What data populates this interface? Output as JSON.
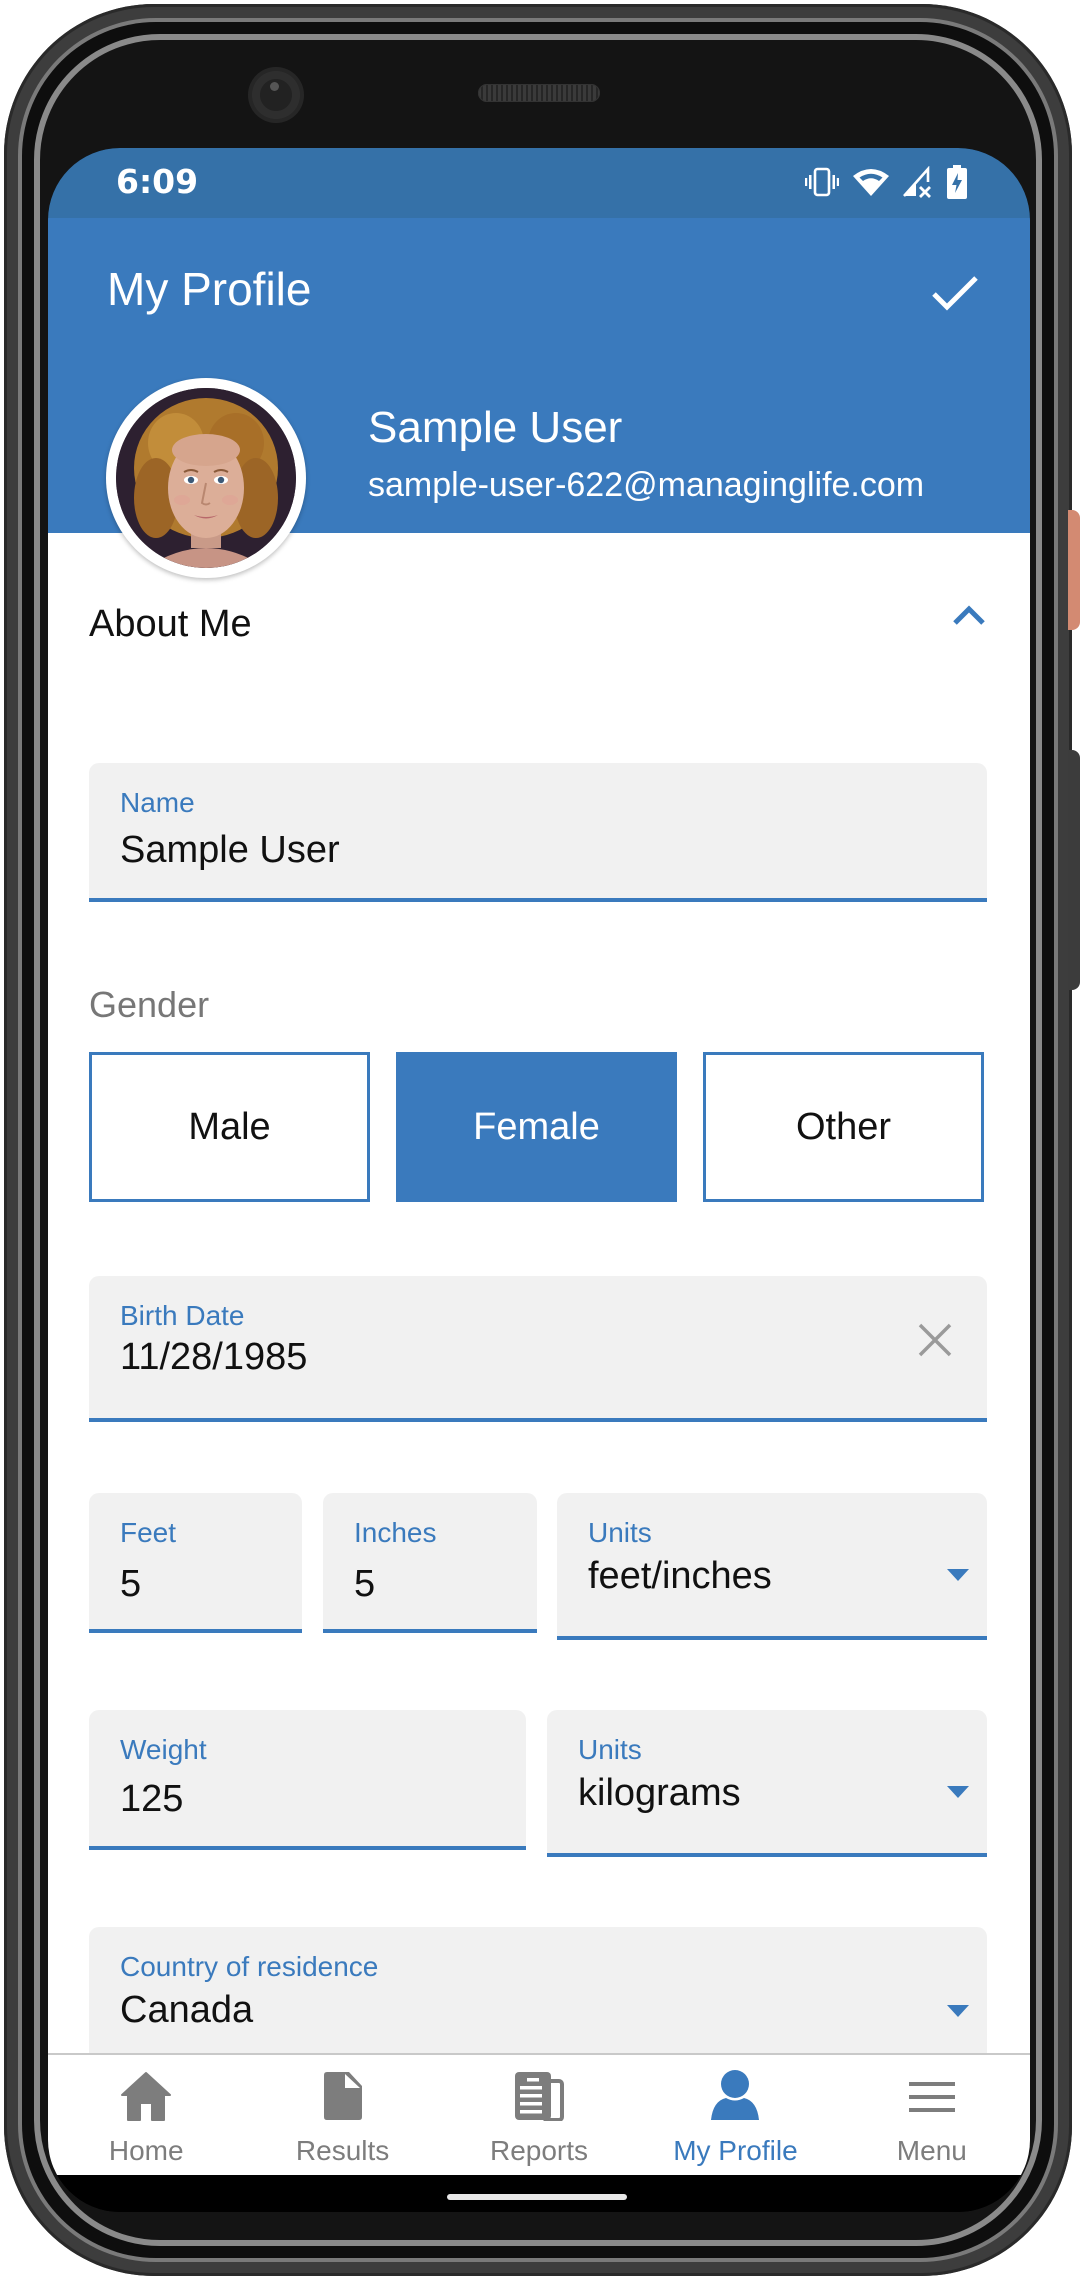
{
  "status_bar": {
    "time": "6:09",
    "icons": [
      "vibrate-icon",
      "wifi-icon",
      "cellular-no-signal-icon",
      "battery-charging-icon"
    ]
  },
  "header": {
    "title": "My Profile",
    "save_icon": "checkmark-icon"
  },
  "profile": {
    "name": "Sample User",
    "email": "sample-user-622@managinglife.com",
    "avatar_alt": "Profile photo"
  },
  "about_section": {
    "title": "About Me",
    "expanded": true,
    "toggle_icon": "chevron-up-icon"
  },
  "form": {
    "name": {
      "label": "Name",
      "value": "Sample User"
    },
    "gender": {
      "label": "Gender",
      "options": [
        "Male",
        "Female",
        "Other"
      ],
      "selected": "Female"
    },
    "birth_date": {
      "label": "Birth Date",
      "value": "11/28/1985",
      "clear_icon": "close-icon"
    },
    "height_feet": {
      "label": "Feet",
      "value": "5"
    },
    "height_inches": {
      "label": "Inches",
      "value": "5"
    },
    "height_units": {
      "label": "Units",
      "value": "feet/inches"
    },
    "weight": {
      "label": "Weight",
      "value": "125"
    },
    "weight_units": {
      "label": "Units",
      "value": "kilograms"
    },
    "country": {
      "label": "Country of residence",
      "value": "Canada"
    }
  },
  "bottom_nav": {
    "items": [
      {
        "label": "Home",
        "icon": "home-icon",
        "active": false
      },
      {
        "label": "Results",
        "icon": "document-icon",
        "active": false
      },
      {
        "label": "Reports",
        "icon": "reports-icon",
        "active": false
      },
      {
        "label": "My Profile",
        "icon": "person-icon",
        "active": true
      },
      {
        "label": "Menu",
        "icon": "hamburger-menu-icon",
        "active": false
      }
    ]
  },
  "colors": {
    "primary": "#3a7abd",
    "status_bar": "#3571a8",
    "field_bg": "#f1f1f1",
    "inactive_nav": "#7d7d7d",
    "side_button": "#d38a72"
  }
}
